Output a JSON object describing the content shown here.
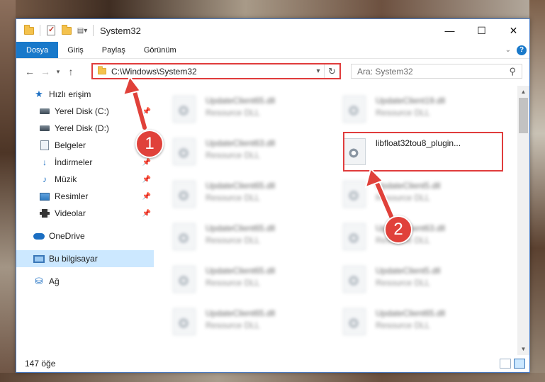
{
  "window": {
    "title": "System32",
    "controls": {
      "minimize": "—",
      "maximize": "☐",
      "close": "✕"
    }
  },
  "ribbon": {
    "tabs": [
      {
        "label": "Dosya"
      },
      {
        "label": "Giriş"
      },
      {
        "label": "Paylaş"
      },
      {
        "label": "Görünüm"
      }
    ],
    "help": "?"
  },
  "nav": {
    "address_path": "C:\\Windows\\System32",
    "search_placeholder": "Ara: System32"
  },
  "sidebar": {
    "items": [
      {
        "label": "Hızlı erişim",
        "icon": "star-icon",
        "pinned": false
      },
      {
        "label": "Yerel Disk (C:)",
        "icon": "drive-icon",
        "pinned": true
      },
      {
        "label": "Yerel Disk (D:)",
        "icon": "drive-icon",
        "pinned": false
      },
      {
        "label": "Belgeler",
        "icon": "documents-icon",
        "pinned": false
      },
      {
        "label": "İndirmeler",
        "icon": "downloads-icon",
        "pinned": true
      },
      {
        "label": "Müzik",
        "icon": "music-icon",
        "pinned": true
      },
      {
        "label": "Resimler",
        "icon": "pictures-icon",
        "pinned": true
      },
      {
        "label": "Videolar",
        "icon": "videos-icon",
        "pinned": true
      },
      {
        "label": "OneDrive",
        "icon": "onedrive-icon"
      },
      {
        "label": "Bu bilgisayar",
        "icon": "computer-icon",
        "selected": true
      },
      {
        "label": "Ağ",
        "icon": "network-icon"
      }
    ]
  },
  "files": [
    {
      "name": "UpdateClient65.dll",
      "type": "Resource DLL",
      "blurred": true
    },
    {
      "name": "UpdateClient19.dll",
      "type": "Resource DLL",
      "blurred": true
    },
    {
      "name": "UpdateClient63.dll",
      "type": "Resource DLL",
      "blurred": true
    },
    {
      "name": "libfloat32tou8_plugin...",
      "type": "",
      "blurred": false,
      "highlighted": true
    },
    {
      "name": "UpdateClient65.dll",
      "type": "Resource DLL",
      "blurred": true
    },
    {
      "name": "UpdateClient5.dll",
      "type": "Resource DLL",
      "blurred": true
    },
    {
      "name": "UpdateClient65.dll",
      "type": "Resource DLL",
      "blurred": true
    },
    {
      "name": "UpdateClient63.dll",
      "type": "Resource DLL",
      "blurred": true
    },
    {
      "name": "UpdateClient65.dll",
      "type": "Resource DLL",
      "blurred": true
    },
    {
      "name": "UpdateClient5.dll",
      "type": "Resource DLL",
      "blurred": true
    },
    {
      "name": "UpdateClient65.dll",
      "type": "Resource DLL",
      "blurred": true
    },
    {
      "name": "UpdateClient65.dll",
      "type": "Resource DLL",
      "blurred": true
    }
  ],
  "status": {
    "item_count": "147 öğe"
  },
  "annotations": [
    {
      "number": "1",
      "color": "#e0413a"
    },
    {
      "number": "2",
      "color": "#e0413a"
    }
  ]
}
